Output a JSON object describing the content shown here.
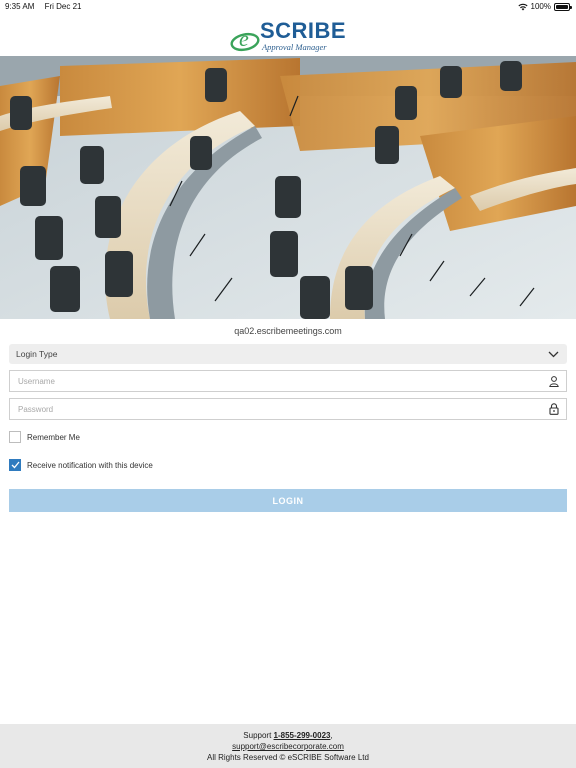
{
  "status_bar": {
    "time": "9:35 AM",
    "date": "Fri Dec 21",
    "battery": "100%",
    "battery_level": 1.0
  },
  "logo": {
    "brand_letter": "e",
    "brand_name": "SCRIBE",
    "subtitle": "Approval Manager"
  },
  "hero": {
    "icon": "council-chamber-photo"
  },
  "domain": "qa02.escribemeetings.com",
  "login_type": {
    "label": "Login Type"
  },
  "username": {
    "placeholder": "Username",
    "value": ""
  },
  "password": {
    "placeholder": "Password",
    "value": ""
  },
  "remember_me": {
    "label": "Remember Me",
    "checked": false
  },
  "notification": {
    "label": "Receive notification with this device",
    "checked": true
  },
  "login_button": {
    "label": "LOGIN"
  },
  "footer": {
    "support_prefix": "Support ",
    "phone": "1-855-299-0023",
    "comma": ",",
    "email": "support@escribecorporate.com",
    "rights": "All Rights Reserved © eSCRIBE Software Ltd"
  },
  "colors": {
    "brand_blue": "#1f5d96",
    "brand_green": "#3aa35a",
    "checkbox_blue": "#2f7bbf",
    "login_button": "#a9cde8",
    "footer_bg": "#e8e8e8"
  }
}
